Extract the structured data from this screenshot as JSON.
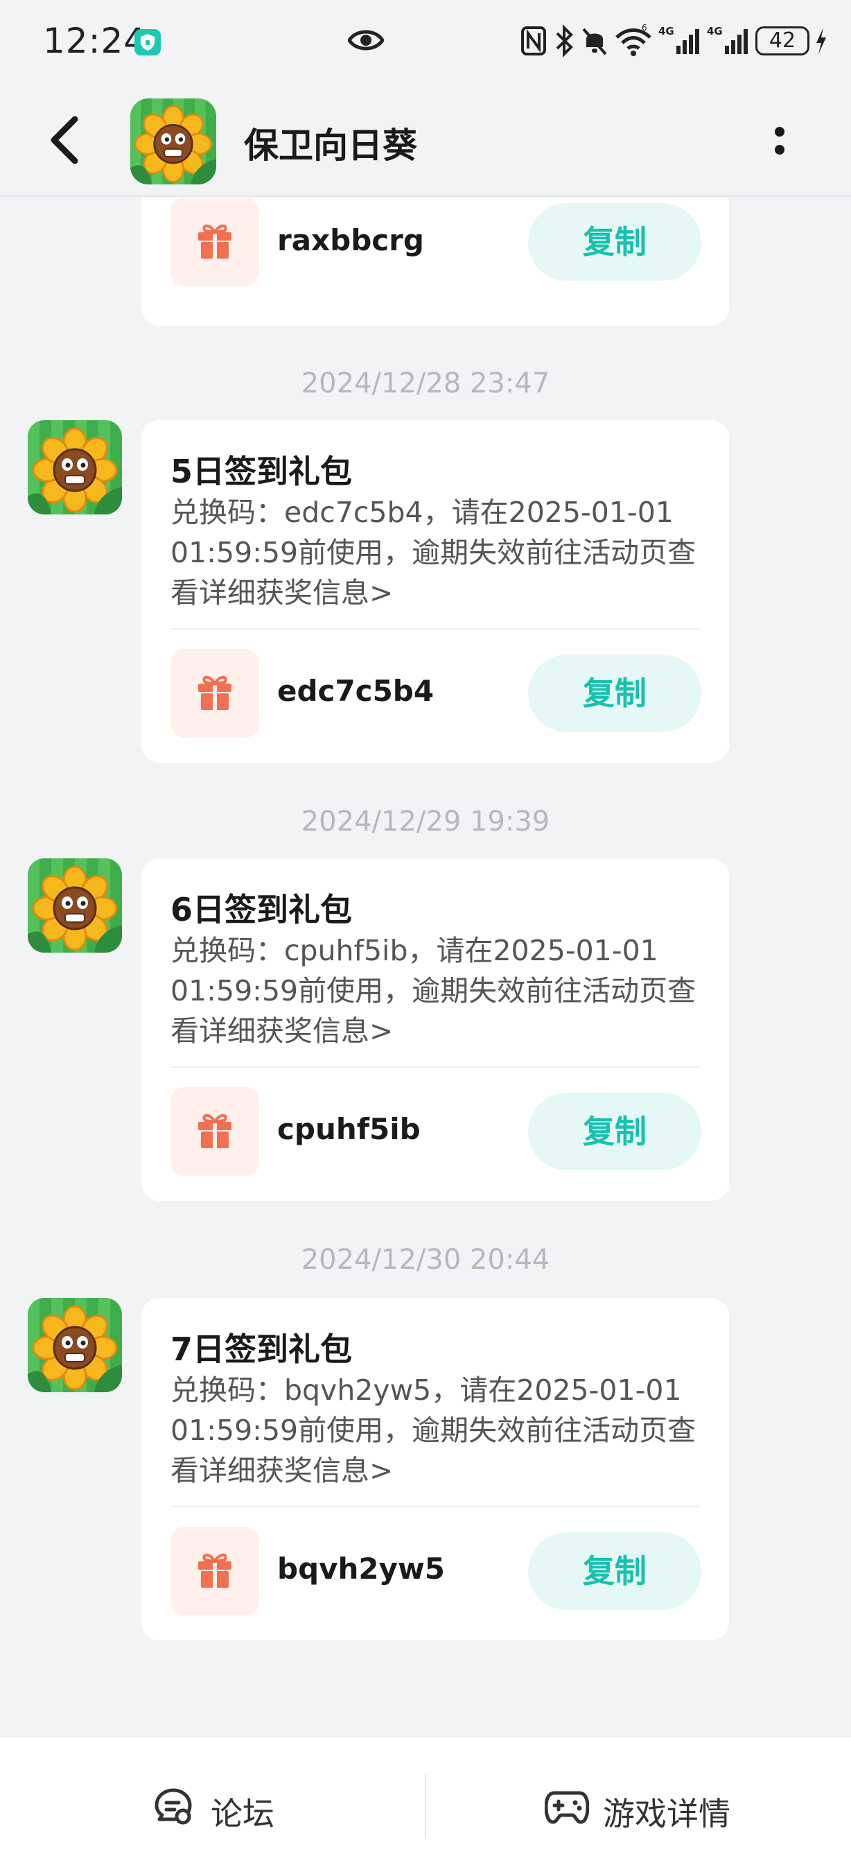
{
  "status_bar": {
    "time": "12:24",
    "battery": "42"
  },
  "header": {
    "title": "保卫向日葵"
  },
  "messages": [
    {
      "timestamp": "",
      "title": "",
      "desc": "",
      "code": "raxbbcrg",
      "copy_label": "复制"
    },
    {
      "timestamp": "2024/12/28  23:47",
      "title": "5日签到礼包",
      "desc": "兑换码：edc7c5b4，请在2025-01-01 01:59:59前使用，逾期失效前往活动页查看详细获奖信息>",
      "code": "edc7c5b4",
      "copy_label": "复制"
    },
    {
      "timestamp": "2024/12/29  19:39",
      "title": "6日签到礼包",
      "desc": "兑换码：cpuhf5ib，请在2025-01-01 01:59:59前使用，逾期失效前往活动页查看详细获奖信息>",
      "code": "cpuhf5ib",
      "copy_label": "复制"
    },
    {
      "timestamp": "2024/12/30  20:44",
      "title": "7日签到礼包",
      "desc": "兑换码：bqvh2yw5，请在2025-01-01 01:59:59前使用，逾期失效前往活动页查看详细获奖信息>",
      "code": "bqvh2yw5",
      "copy_label": "复制"
    }
  ],
  "bottom_bar": {
    "forum_label": "论坛",
    "game_details_label": "游戏详情"
  },
  "colors": {
    "accent": "#17c2ad",
    "gift": "#f26f4f",
    "background": "#f2f3f5"
  }
}
